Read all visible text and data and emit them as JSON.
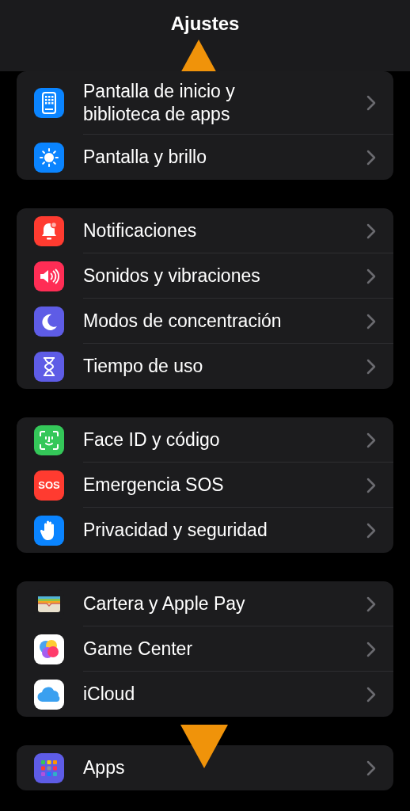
{
  "header": {
    "title": "Ajustes"
  },
  "groups": [
    {
      "rows": [
        {
          "label": "Pantalla de inicio y biblioteca de apps",
          "kind": "home-screen",
          "color": "#0a84ff"
        },
        {
          "label": "Pantalla y brillo",
          "kind": "sun",
          "color": "#0a84ff"
        }
      ]
    },
    {
      "rows": [
        {
          "label": "Notificaciones",
          "kind": "bell",
          "color": "#ff3b30"
        },
        {
          "label": "Sonidos y vibraciones",
          "kind": "speaker",
          "color": "#ff2d55"
        },
        {
          "label": "Modos de concentración",
          "kind": "moon",
          "color": "#5e5ce6"
        },
        {
          "label": "Tiempo de uso",
          "kind": "hourglass",
          "color": "#5e5ce6"
        }
      ]
    },
    {
      "rows": [
        {
          "label": "Face ID y código",
          "kind": "face",
          "color": "#34c759"
        },
        {
          "label": "Emergencia SOS",
          "kind": "sos",
          "color": "#ff3b30",
          "icon_text": "SOS"
        },
        {
          "label": "Privacidad y seguridad",
          "kind": "hand",
          "color": "#0a84ff"
        }
      ]
    },
    {
      "rows": [
        {
          "label": "Cartera y Apple Pay",
          "kind": "wallet",
          "color": "#1c1c1e"
        },
        {
          "label": "Game Center",
          "kind": "bubbles",
          "color": "#ffffff"
        },
        {
          "label": "iCloud",
          "kind": "cloud",
          "color": "#ffffff"
        }
      ]
    },
    {
      "rows": [
        {
          "label": "Apps",
          "kind": "grid",
          "color": "#5e5ce6"
        }
      ]
    }
  ]
}
